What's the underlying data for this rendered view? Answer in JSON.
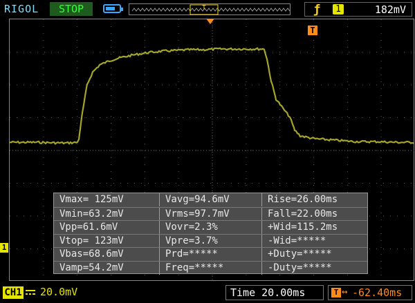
{
  "header": {
    "brand": "RIGOL",
    "run_state": "STOP",
    "run_state_color": "#35ff35",
    "battery_icon": "battery-icon",
    "battery_level": 0.7,
    "memory_strip_icon": "memory-depth-strip",
    "trigger": {
      "edge_icon": "rising-edge-icon",
      "edge_glyph": "ƒ",
      "source": "1",
      "level": "182mV"
    }
  },
  "screen": {
    "trigger_marker_label": "T",
    "channel_marker_label": "1",
    "trace_color": "#a5a52a",
    "grid_color": "#5a5a5a",
    "waveform": {
      "x": [
        0,
        40,
        80,
        98,
        100,
        105,
        112,
        120,
        130,
        145,
        160,
        180,
        200,
        220,
        240,
        260,
        280,
        300,
        320,
        340,
        360,
        368,
        372,
        378,
        385,
        395,
        405,
        412,
        420,
        440,
        470,
        500,
        530,
        560,
        586
      ],
      "y": [
        -0.05,
        -0.05,
        -0.06,
        -0.05,
        0.0,
        0.35,
        0.75,
        0.92,
        1.02,
        1.08,
        1.12,
        1.16,
        1.19,
        1.21,
        1.22,
        1.23,
        1.23,
        1.24,
        1.24,
        1.24,
        1.24,
        1.24,
        1.1,
        0.8,
        0.55,
        0.42,
        0.3,
        0.12,
        0.04,
        0.0,
        -0.02,
        -0.04,
        -0.04,
        -0.05,
        -0.05
      ]
    }
  },
  "measurements": [
    [
      "Vmax= 125mV",
      "Vavg=94.6mV",
      "Rise=26.00ms"
    ],
    [
      "Vmin=63.2mV",
      "Vrms=97.7mV",
      "Fall=22.00ms"
    ],
    [
      "Vpp=61.6mV",
      "Vovr=2.3%",
      "+Wid=115.2ms"
    ],
    [
      "Vtop= 123mV",
      "Vpre=3.7%",
      "-Wid=*****"
    ],
    [
      "Vbas=68.6mV",
      "Prd=*****",
      "+Duty=*****"
    ],
    [
      "Vamp=54.2mV",
      "Freq=*****",
      "-Duty=*****"
    ]
  ],
  "footer": {
    "channel_label": "CH1",
    "coupling_icon": "dc-coupling-icon",
    "volts_per_div": "20.0mV",
    "time_label": "Time 20.00ms",
    "trigger_offset_icon": "trigger-offset-icon",
    "trigger_offset_arrow": "↔",
    "trigger_offset": "-62.40ms"
  }
}
